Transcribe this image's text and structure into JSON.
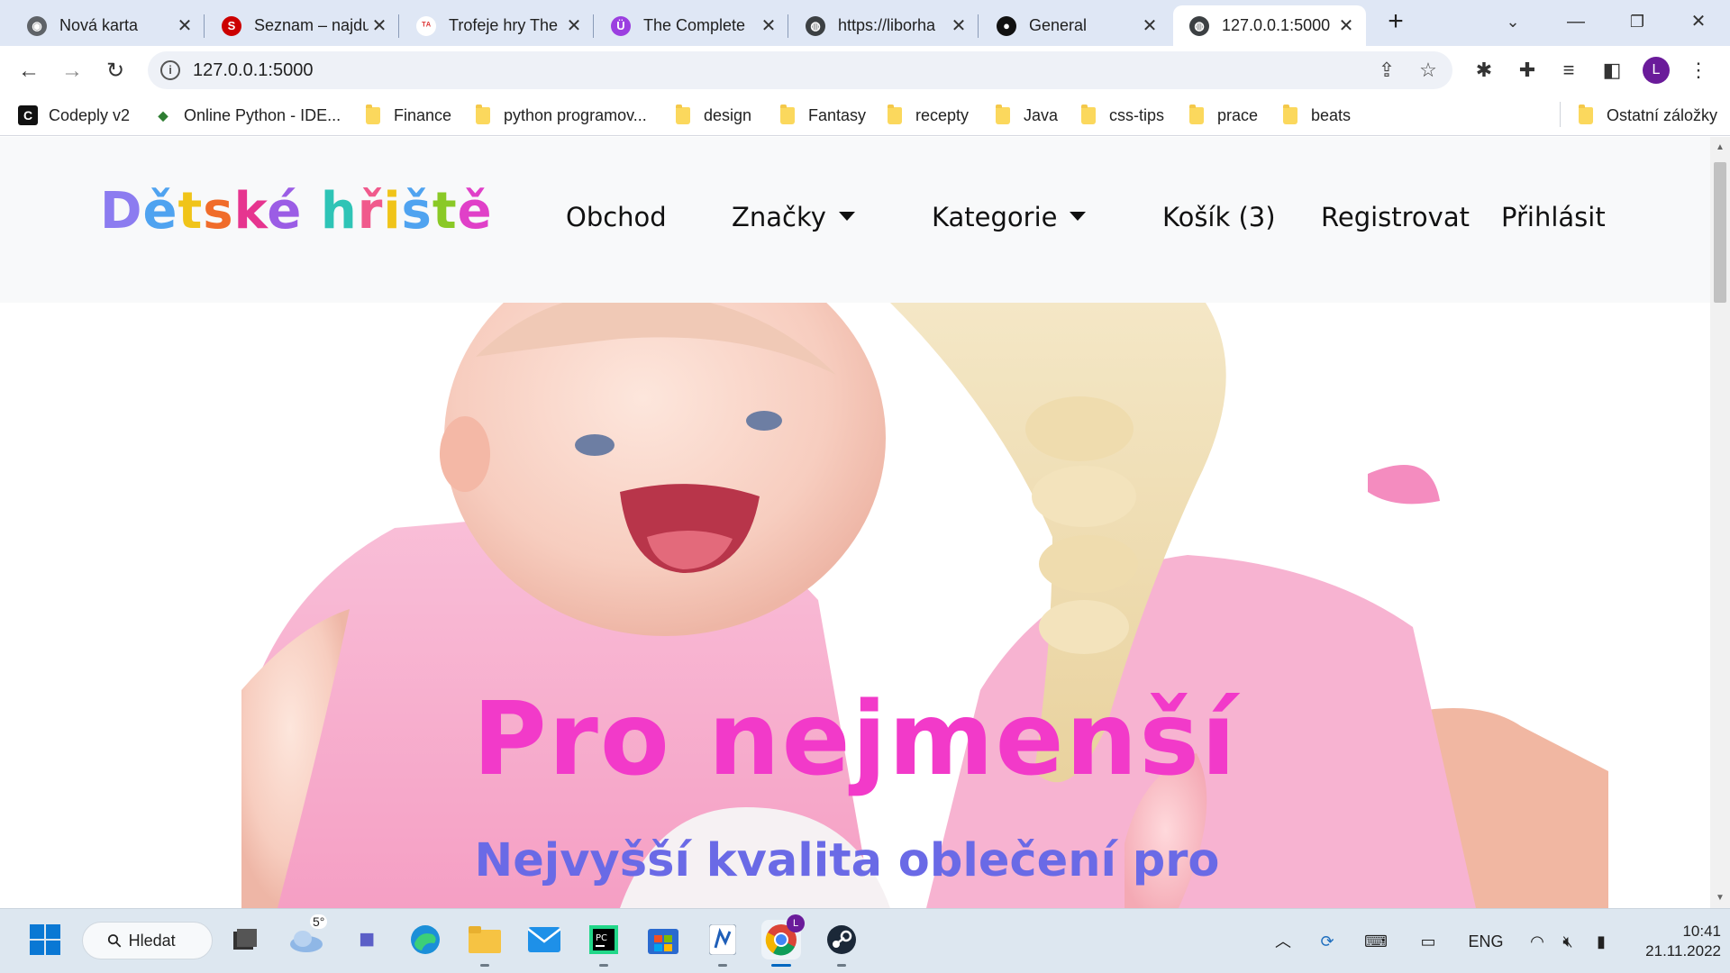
{
  "browser": {
    "tabs": [
      {
        "title": "Nová karta",
        "favicon_color": "#5f6368",
        "favicon_glyph": "◉",
        "active": false
      },
      {
        "title": "Seznam – najdu",
        "favicon_color": "#cc0000",
        "favicon_glyph": "S",
        "active": false
      },
      {
        "title": "Trofeje hry The",
        "favicon_color": "#ffffff",
        "favicon_glyph": "✕",
        "active": false
      },
      {
        "title": "The Complete",
        "favicon_color": "#9b3fe0",
        "favicon_glyph": "Ü",
        "active": false
      },
      {
        "title": "https://liborha",
        "favicon_color": "#3c4043",
        "favicon_glyph": "◍",
        "active": false
      },
      {
        "title": "General",
        "favicon_color": "#111111",
        "favicon_glyph": "●",
        "active": false
      },
      {
        "title": "127.0.0.1:5000",
        "favicon_color": "#3c4043",
        "favicon_glyph": "◍",
        "active": true
      }
    ],
    "url": "127.0.0.1:5000",
    "profile_initial": "L",
    "bookmarks": [
      {
        "label": "Codeply v2",
        "type": "site",
        "icon_glyph": "C",
        "icon_color": "#111111"
      },
      {
        "label": "Online Python - IDE...",
        "type": "site",
        "icon_glyph": "◆",
        "icon_color": "#2e7d32"
      },
      {
        "label": "Finance",
        "type": "folder"
      },
      {
        "label": "python programov...",
        "type": "folder"
      },
      {
        "label": "design",
        "type": "folder"
      },
      {
        "label": "Fantasy",
        "type": "folder"
      },
      {
        "label": "recepty",
        "type": "folder"
      },
      {
        "label": "Java",
        "type": "folder"
      },
      {
        "label": "css-tips",
        "type": "folder"
      },
      {
        "label": "prace",
        "type": "folder"
      },
      {
        "label": "beats",
        "type": "folder"
      }
    ],
    "other_bookmarks": "Ostatní záložky"
  },
  "site": {
    "brand_letters": [
      {
        "ch": "D",
        "color": "#8c7cf0"
      },
      {
        "ch": "ě",
        "color": "#4fa3f0"
      },
      {
        "ch": "t",
        "color": "#f0c419"
      },
      {
        "ch": "s",
        "color": "#f06c2a"
      },
      {
        "ch": "k",
        "color": "#e6358f"
      },
      {
        "ch": "é",
        "color": "#9b5de5"
      },
      {
        "ch": " ",
        "color": "#000000"
      },
      {
        "ch": "h",
        "color": "#2ec4b6"
      },
      {
        "ch": "ř",
        "color": "#f05a8c"
      },
      {
        "ch": "i",
        "color": "#f0c419"
      },
      {
        "ch": "š",
        "color": "#4fa3f0"
      },
      {
        "ch": "t",
        "color": "#8ac926"
      },
      {
        "ch": "ě",
        "color": "#e040c8"
      }
    ],
    "nav": {
      "shop": "Obchod",
      "brands": "Značky",
      "categories": "Kategorie",
      "cart": "Košík (3)",
      "register": "Registrovat",
      "login": "Přihlásit"
    },
    "hero": {
      "title": "Pro nejmenší",
      "subtitle": "Nejvyšší kvalita oblečení pro nejmenší."
    }
  },
  "taskbar": {
    "search_label": "Hledat",
    "weather": "5°",
    "language": "ENG",
    "time": "10:41",
    "date": "21.11.2022"
  }
}
